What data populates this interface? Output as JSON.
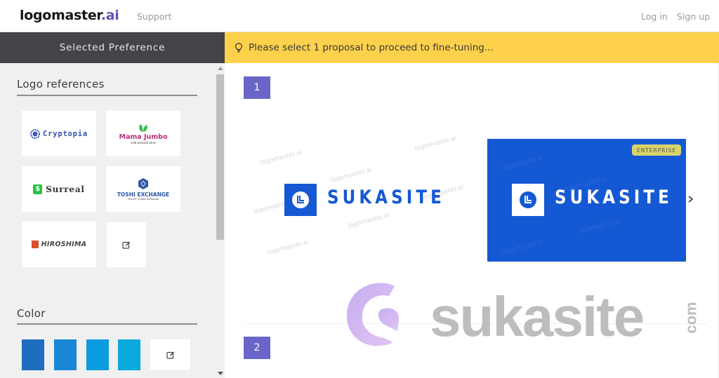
{
  "header": {
    "brand_main": "logomaster",
    "brand_suffix": ".ai",
    "support_link": "Support",
    "login_link": "Log in",
    "signup_link": "Sign up"
  },
  "sidebar": {
    "title": "Selected Preference",
    "logo_references": {
      "heading": "Logo references",
      "items": [
        {
          "name": "Cryptopia",
          "tagline": ""
        },
        {
          "name": "Mama Jumbo",
          "tagline": "cold pressed juice"
        },
        {
          "name": "Surreal",
          "tagline": ""
        },
        {
          "name": "TOSHI EXCHANGE",
          "tagline": "The #1 Crypto Exchange"
        },
        {
          "name": "HIROSHIMA",
          "tagline": ""
        }
      ],
      "edit_icon": "edit-icon"
    },
    "color": {
      "heading": "Color",
      "swatches": [
        "#1e6dbf",
        "#1a86d6",
        "#0a9be0",
        "#0aa9dc"
      ],
      "edit_icon": "edit-icon"
    }
  },
  "notice": {
    "icon": "lightbulb-icon",
    "text": "Please select 1 proposal to proceed to fine-tuning..."
  },
  "proposals": [
    {
      "number": "1",
      "brand_text": "SUKASITE",
      "watermark": "logomaster.ai",
      "variants": [
        {
          "style": "light",
          "background": "#ffffff",
          "accent": "#1458d4"
        },
        {
          "style": "dark",
          "background": "#1458d4",
          "accent": "#ffffff",
          "tag": "ENTERPRISE"
        }
      ],
      "next_icon": "chevron-right-icon"
    },
    {
      "number": "2"
    }
  ],
  "overlay_watermark": {
    "text": "sukasite",
    "suffix": "com"
  },
  "colors": {
    "accent": "#6a66c9",
    "notice_bg": "#fdd14b",
    "sidebar_head_bg": "#444448",
    "logo_blue": "#1458d4"
  }
}
